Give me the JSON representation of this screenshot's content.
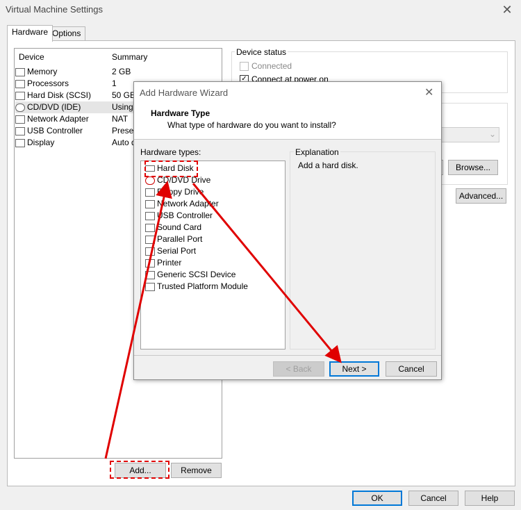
{
  "window": {
    "title": "Virtual Machine Settings",
    "close_glyph": "✕"
  },
  "tabs": [
    {
      "label": "Hardware"
    },
    {
      "label": "Options"
    }
  ],
  "device_list": {
    "headers": {
      "device": "Device",
      "summary": "Summary"
    },
    "rows": [
      {
        "name": "Memory",
        "summary": "2 GB",
        "icon": "memory-icon"
      },
      {
        "name": "Processors",
        "summary": "1",
        "icon": "processor-icon"
      },
      {
        "name": "Hard Disk (SCSI)",
        "summary": "50 GB",
        "icon": "hard-disk-icon"
      },
      {
        "name": "CD/DVD (IDE)",
        "summary": "Using f",
        "icon": "cd-dvd-icon"
      },
      {
        "name": "Network Adapter",
        "summary": "NAT",
        "icon": "network-adapter-icon"
      },
      {
        "name": "USB Controller",
        "summary": "Presen",
        "icon": "usb-icon"
      },
      {
        "name": "Display",
        "summary": "Auto d",
        "icon": "display-icon"
      }
    ],
    "add_label": "Add...",
    "remove_label": "Remove"
  },
  "device_status": {
    "title": "Device status",
    "connected_label": "Connected",
    "connected_checked": false,
    "connect_power_label": "Connect at power on",
    "connect_power_checked": true
  },
  "right_panel": {
    "browse_label": "Browse...",
    "advanced_label": "Advanced..."
  },
  "footer": {
    "ok_label": "OK",
    "cancel_label": "Cancel",
    "help_label": "Help"
  },
  "wizard": {
    "title": "Add Hardware Wizard",
    "close_glyph": "✕",
    "heading": "Hardware Type",
    "subheading": "What type of hardware do you want to install?",
    "types_label": "Hardware types:",
    "hardware_types": [
      {
        "label": "Hard Disk",
        "icon": "hard-disk-icon"
      },
      {
        "label": "CD/DVD Drive",
        "icon": "cd-dvd-icon"
      },
      {
        "label": "Floppy Drive",
        "icon": "floppy-icon"
      },
      {
        "label": "Network Adapter",
        "icon": "network-adapter-icon"
      },
      {
        "label": "USB Controller",
        "icon": "usb-icon"
      },
      {
        "label": "Sound Card",
        "icon": "sound-card-icon"
      },
      {
        "label": "Parallel Port",
        "icon": "parallel-port-icon"
      },
      {
        "label": "Serial Port",
        "icon": "serial-port-icon"
      },
      {
        "label": "Printer",
        "icon": "printer-icon"
      },
      {
        "label": "Generic SCSI Device",
        "icon": "scsi-device-icon"
      },
      {
        "label": "Trusted Platform Module",
        "icon": "tpm-icon"
      }
    ],
    "explanation_label": "Explanation",
    "explanation_text": "Add a hard disk.",
    "back_label": "< Back",
    "next_label": "Next >",
    "cancel_label": "Cancel"
  },
  "colors": {
    "annotation_red": "#e00000",
    "primary_border": "#0078d7"
  }
}
